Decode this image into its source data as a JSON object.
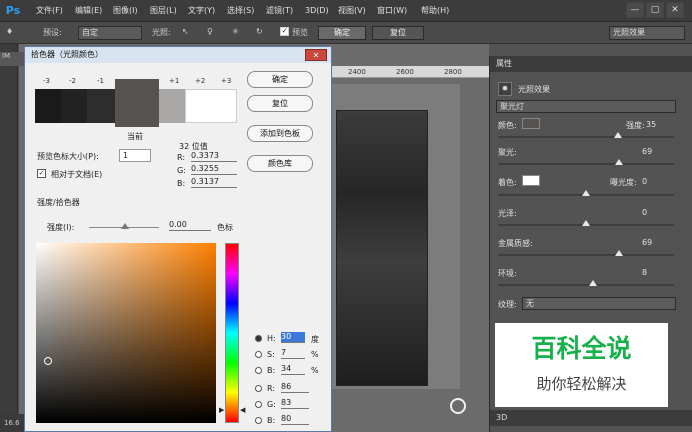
{
  "app": {
    "logo": "Ps"
  },
  "menu": [
    "文件(F)",
    "编辑(E)",
    "图像(I)",
    "图层(L)",
    "文字(Y)",
    "选择(S)",
    "滤镜(T)",
    "3D(D)",
    "视图(V)",
    "窗口(W)",
    "帮助(H)"
  ],
  "window_controls": {
    "minimize": "—",
    "restore": "▢",
    "close": "✕"
  },
  "options": {
    "preset_label": "预设:",
    "preset_value": "自定",
    "light_label": "光照:",
    "preview_label": "预览",
    "ok_label": "确定",
    "reset_label": "复位",
    "effect_value": "光照效果"
  },
  "document": {
    "tab": "IM",
    "status": "16.6",
    "ruler": [
      "2400",
      "2600",
      "2800"
    ]
  },
  "color_picker": {
    "title": "拾色器（光照颜色）",
    "close": "✕",
    "swatch_labels": [
      "-3",
      "-2",
      "-1",
      "+1",
      "+2",
      "+3"
    ],
    "current_label": "当前",
    "bit_label": "32 位值",
    "r_label": "R:",
    "r_value": "0.3373",
    "g_label": "G:",
    "g_value": "0.3255",
    "b_label": "B:",
    "b_value": "0.3137",
    "preview_size_label": "预览色标大小(P):",
    "preview_size_value": "1",
    "relative_label": "相对于文档(E)",
    "section_label": "强度/拾色器",
    "intensity_label": "强度(I):",
    "intensity_value": "0.00",
    "intensity_unit": "色标",
    "buttons": {
      "ok": "确定",
      "reset": "复位",
      "add": "添加到色板",
      "library": "颜色库"
    },
    "hsb": [
      {
        "label": "H:",
        "value": "30",
        "unit": "度"
      },
      {
        "label": "S:",
        "value": "7",
        "unit": "%"
      },
      {
        "label": "B:",
        "value": "34",
        "unit": "%"
      }
    ],
    "rgb": [
      {
        "label": "R:",
        "value": "86"
      },
      {
        "label": "G:",
        "value": "83"
      },
      {
        "label": "B:",
        "value": "80"
      }
    ],
    "current_color": "#565350"
  },
  "properties": {
    "header": "属性",
    "effect_label": "光照效果",
    "light_type": "聚光灯",
    "color_label": "颜色:",
    "intensity_label": "强度:",
    "intensity_value": "35",
    "hotspot_label": "聚光:",
    "hotspot_value": "69",
    "tint_label": "着色:",
    "exposure_label": "曝光度:",
    "exposure_value": "0",
    "gloss_label": "光泽:",
    "gloss_value": "0",
    "metallic_label": "金属质感:",
    "metallic_value": "69",
    "ambience_label": "环境:",
    "ambience_value": "8",
    "texture_label": "纹理:",
    "texture_value": "无",
    "panel3d": "3D",
    "sliders": {
      "intensity": 0.68,
      "hotspot": 0.69,
      "exposure": 0.5,
      "gloss": 0.5,
      "metallic": 0.69,
      "ambience": 0.54
    }
  },
  "watermark": {
    "title": "百科全说",
    "subtitle": "助你轻松解决"
  }
}
